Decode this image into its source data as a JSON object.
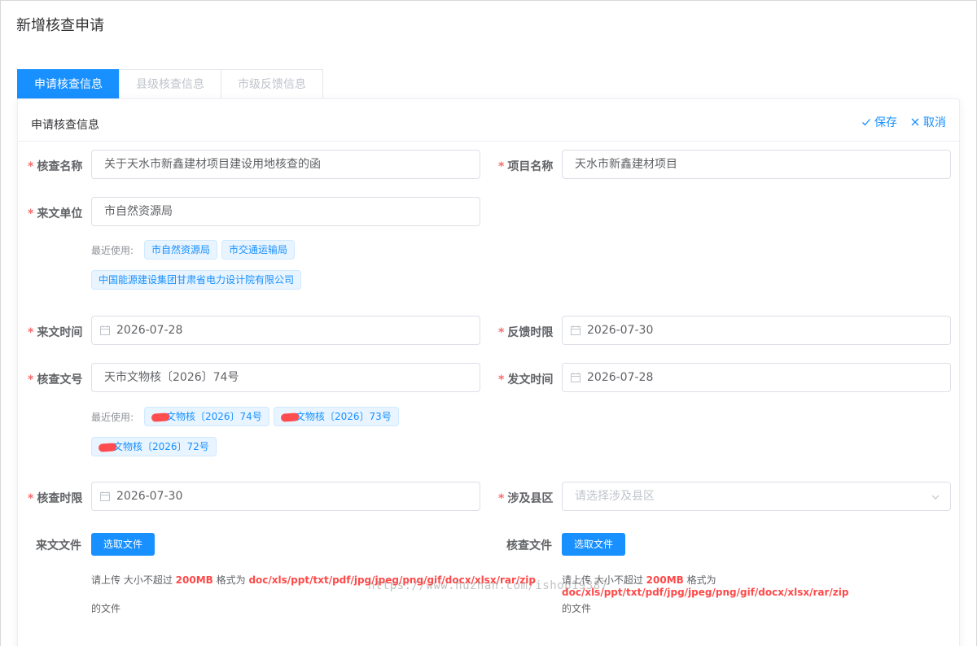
{
  "dialog": {
    "title": "新增核查申请"
  },
  "tabs": [
    {
      "label": "申请核查信息",
      "active": true
    },
    {
      "label": "县级核查信息",
      "active": false
    },
    {
      "label": "市级反馈信息",
      "active": false
    }
  ],
  "card": {
    "title": "申请核查信息",
    "save_label": "保存",
    "cancel_label": "取消"
  },
  "form": {
    "check_name": {
      "label": "核查名称",
      "value": "关于天水市新鑫建材项目建设用地核查的函"
    },
    "project_name": {
      "label": "项目名称",
      "value": "天水市新鑫建材项目"
    },
    "source_unit": {
      "label": "来文单位",
      "value": "市自然资源局"
    },
    "source_unit_recent": {
      "label": "最近使用:",
      "tags": [
        "市自然资源局",
        "市交通运输局",
        "中国能源建设集团甘肃省电力设计院有限公司"
      ]
    },
    "source_date": {
      "label": "来文时间",
      "value": "2026-07-28"
    },
    "feedback_deadline": {
      "label": "反馈时限",
      "value": "2026-07-30"
    },
    "check_doc_no": {
      "label": "核查文号",
      "value": "天市文物核〔2026〕74号"
    },
    "issue_date": {
      "label": "发文时间",
      "value": "2026-07-28"
    },
    "doc_no_recent": {
      "label": "最近使用:",
      "tags": [
        "文物核〔2026〕74号",
        "文物核〔2026〕73号",
        "文物核〔2026〕72号"
      ]
    },
    "check_deadline": {
      "label": "核查时限",
      "value": "2026-07-30"
    },
    "county": {
      "label": "涉及县区",
      "placeholder": "请选择涉及县区"
    },
    "source_file": {
      "label": "来文文件",
      "button": "选取文件"
    },
    "check_file": {
      "label": "核查文件",
      "button": "选取文件"
    },
    "upload_tip": {
      "prefix": "请上传 大小不超过",
      "size": "200MB",
      "middle": "格式为",
      "formats": "doc/xls/ppt/txt/pdf/jpg/jpeg/png/gif/docx/xlsx/rar/zip",
      "suffix": "的文件"
    }
  },
  "watermark": "https://www.huzhan.com/ishop19387",
  "colors": {
    "primary": "#1890ff",
    "required": "#f56c6c",
    "tip_emphasis": "#ff4949"
  }
}
